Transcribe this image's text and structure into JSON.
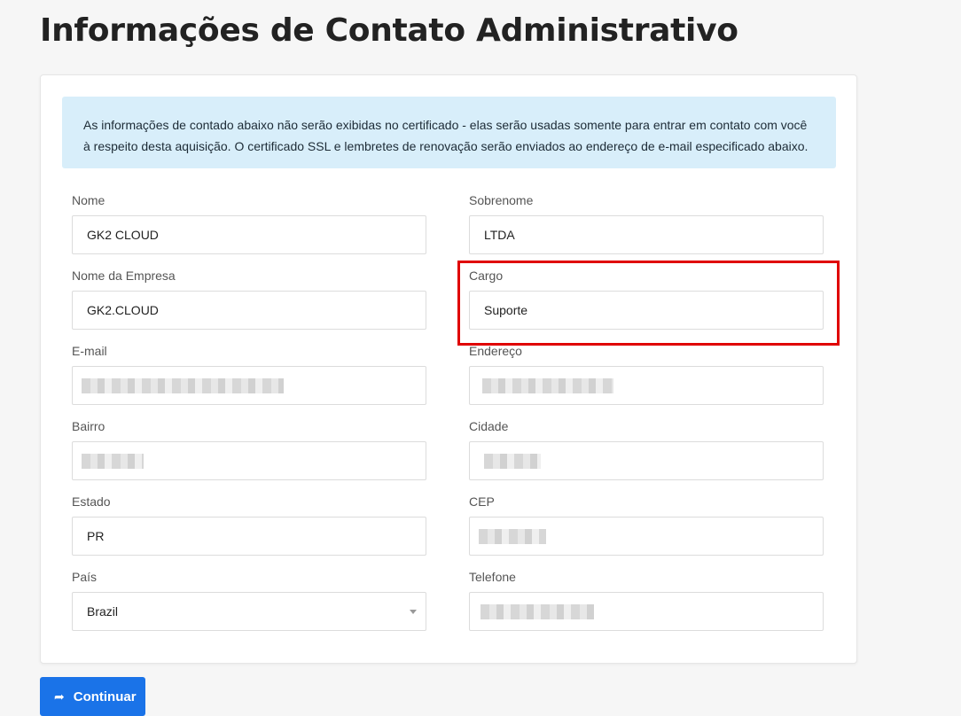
{
  "page": {
    "title": "Informações de Contato Administrativo"
  },
  "alert": {
    "text": "As informações de contado abaixo não serão exibidas no certificado - elas serão usadas somente para entrar em contato com você à respeito desta aquisição. O certificado SSL e lembretes de renovação serão enviados ao endereço de e-mail especificado abaixo."
  },
  "fields": {
    "nome": {
      "label": "Nome",
      "value": "GK2 CLOUD"
    },
    "sobrenome": {
      "label": "Sobrenome",
      "value": "LTDA"
    },
    "empresa": {
      "label": "Nome da Empresa",
      "value": "GK2.CLOUD"
    },
    "cargo": {
      "label": "Cargo",
      "value": "Suporte"
    },
    "email": {
      "label": "E-mail",
      "value": ""
    },
    "endereco": {
      "label": "Endereço",
      "value": ""
    },
    "bairro": {
      "label": "Bairro",
      "value": ""
    },
    "cidade": {
      "label": "Cidade",
      "value": ""
    },
    "estado": {
      "label": "Estado",
      "value": "PR"
    },
    "cep": {
      "label": "CEP",
      "value": ""
    },
    "pais": {
      "label": "País",
      "value": "Brazil"
    },
    "telefone": {
      "label": "Telefone",
      "value": ""
    }
  },
  "actions": {
    "continue_label": "Continuar",
    "continue_icon": "arrow-right-icon"
  },
  "colors": {
    "primary": "#1a73e8",
    "alert_bg": "#d8eefa",
    "highlight": "#e00000"
  }
}
